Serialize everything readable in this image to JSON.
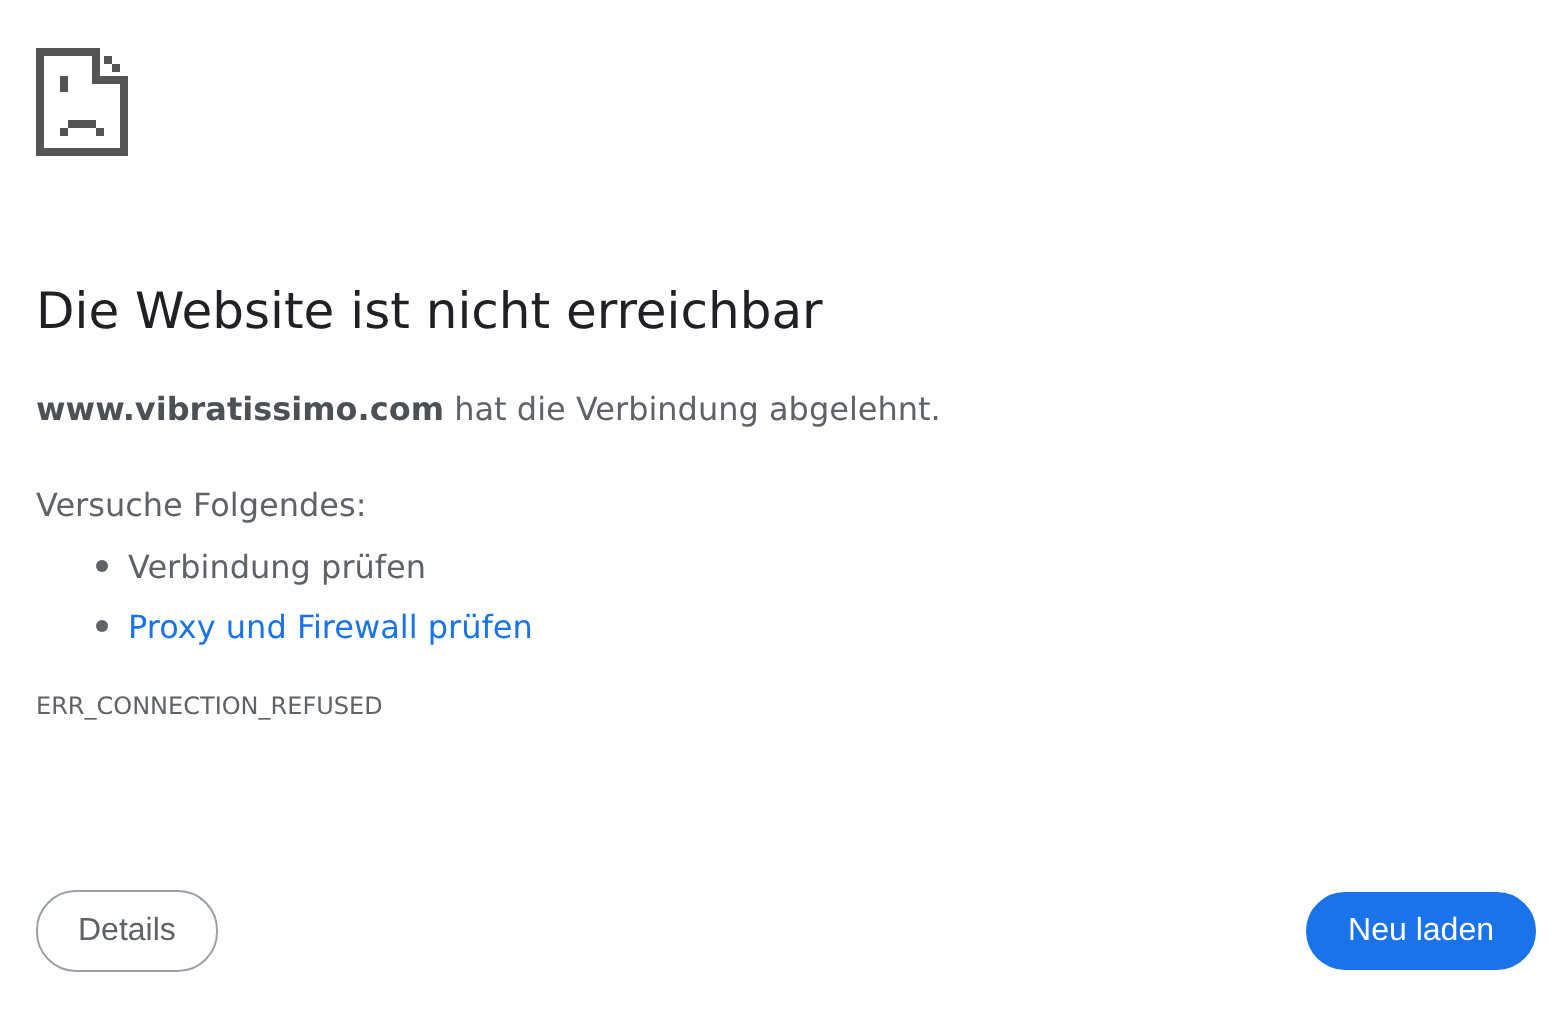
{
  "heading": "Die Website ist nicht erreichbar",
  "description": "**www.vibratissimo.com** hat die Verbindung abgelehnt.",
  "suggestions_intro": "Versuche Folgendes:",
  "suggestions": [
    {
      "kind": "text",
      "label": "Verbindung prüfen"
    },
    {
      "kind": "link",
      "label": "Proxy und Firewall prüfen"
    }
  ],
  "error_code": "ERR_CONNECTION_REFUSED",
  "buttons": [
    {
      "kind": "secondary",
      "label": "Details"
    },
    {
      "kind": "primary",
      "label": "Neu laden"
    }
  ]
}
